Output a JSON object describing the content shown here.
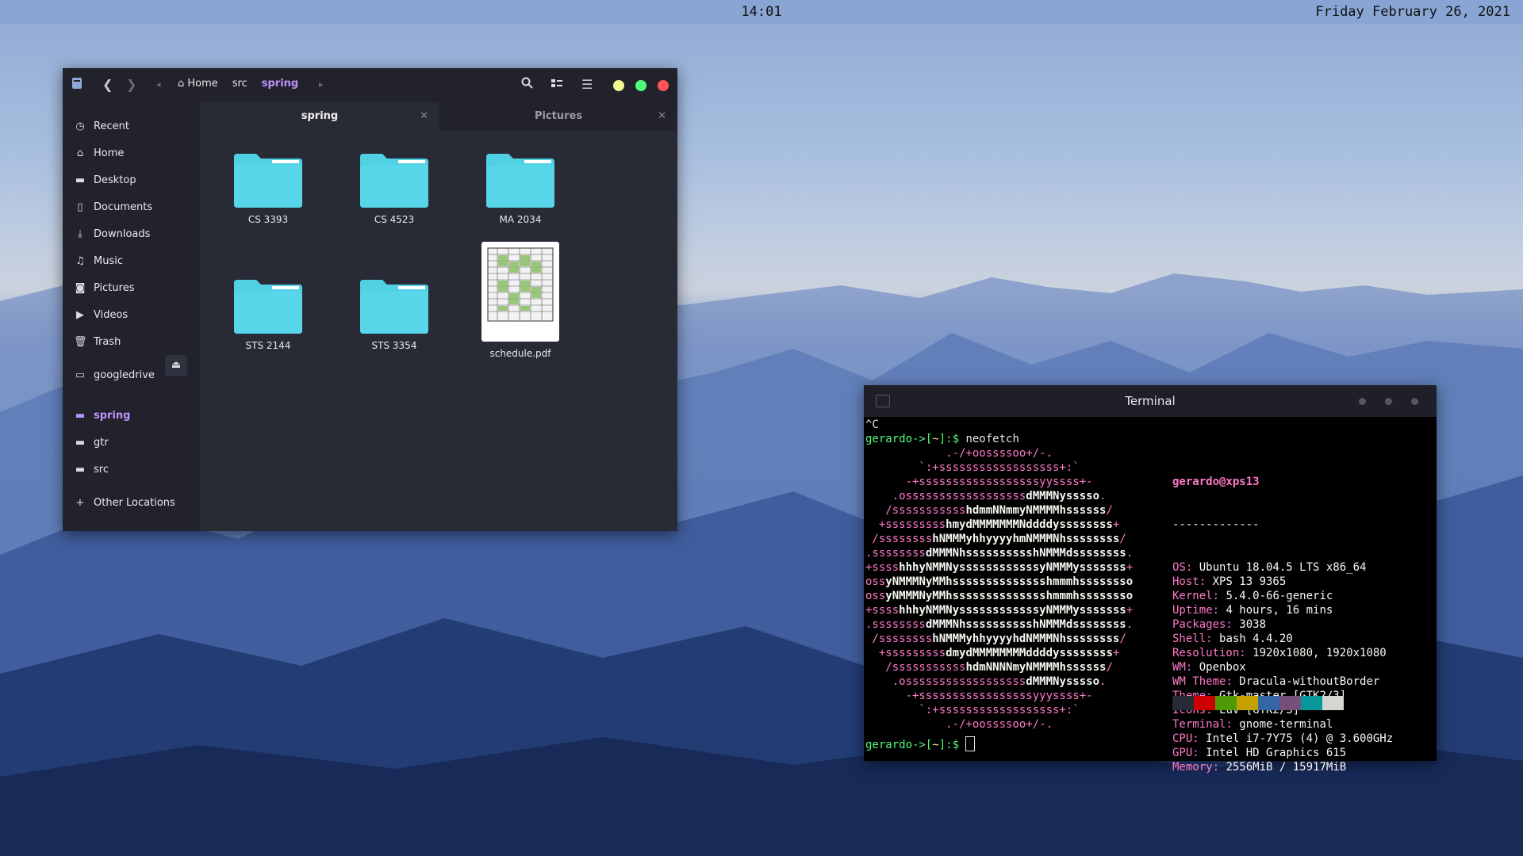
{
  "topbar": {
    "time": "14:01",
    "date": "Friday February 26, 2021"
  },
  "file_manager": {
    "breadcrumbs": [
      "Home",
      "src",
      "spring"
    ],
    "active_crumb": "spring",
    "tabs": [
      {
        "label": "spring",
        "active": true
      },
      {
        "label": "Pictures",
        "active": false
      }
    ],
    "sidebar": {
      "places": [
        {
          "label": "Recent",
          "icon": "clock-icon"
        },
        {
          "label": "Home",
          "icon": "home-icon"
        },
        {
          "label": "Desktop",
          "icon": "folder-icon"
        },
        {
          "label": "Documents",
          "icon": "document-icon"
        },
        {
          "label": "Downloads",
          "icon": "download-icon"
        },
        {
          "label": "Music",
          "icon": "music-icon"
        },
        {
          "label": "Pictures",
          "icon": "camera-icon"
        },
        {
          "label": "Videos",
          "icon": "video-icon"
        },
        {
          "label": "Trash",
          "icon": "trash-icon"
        }
      ],
      "drive": {
        "label": "googledrive",
        "icon": "drive-icon"
      },
      "bookmarks": [
        {
          "label": "spring",
          "icon": "folder-icon",
          "current": true
        },
        {
          "label": "gtr",
          "icon": "folder-icon"
        },
        {
          "label": "src",
          "icon": "folder-icon"
        }
      ],
      "other": {
        "label": "Other Locations",
        "icon": "plus-icon"
      }
    },
    "files": [
      {
        "name": "CS 3393",
        "type": "folder"
      },
      {
        "name": "CS 4523",
        "type": "folder"
      },
      {
        "name": "MA 2034",
        "type": "folder"
      },
      {
        "name": "STS 2144",
        "type": "folder"
      },
      {
        "name": "STS 3354",
        "type": "folder"
      },
      {
        "name": "schedule.pdf",
        "type": "pdf"
      }
    ],
    "colors": {
      "folder": "#4fd1e3",
      "accent": "#bd93f9",
      "close": "#ff5555",
      "maximize": "#50fa7b",
      "minimize": "#f1fa8c"
    }
  },
  "terminal": {
    "title": "Terminal",
    "interrupt": "^C",
    "prompt_user": "gerardo->[",
    "prompt_path": "~",
    "prompt_end": "]:$ ",
    "command": "neofetch",
    "user_host": "gerardo@xps13",
    "separator": "-------------",
    "info": [
      {
        "key": "OS:",
        "value": "Ubuntu 18.04.5 LTS x86_64"
      },
      {
        "key": "Host:",
        "value": "XPS 13 9365"
      },
      {
        "key": "Kernel:",
        "value": "5.4.0-66-generic"
      },
      {
        "key": "Uptime:",
        "value": "4 hours, 16 mins"
      },
      {
        "key": "Packages:",
        "value": "3038"
      },
      {
        "key": "Shell:",
        "value": "bash 4.4.20"
      },
      {
        "key": "Resolution:",
        "value": "1920x1080, 1920x1080"
      },
      {
        "key": "WM:",
        "value": "Openbox"
      },
      {
        "key": "WM Theme:",
        "value": "Dracula-withoutBorder"
      },
      {
        "key": "Theme:",
        "value": "Gtk-master [GTK2/3]"
      },
      {
        "key": "Icons:",
        "value": "Luv [GTK2/3]"
      },
      {
        "key": "Terminal:",
        "value": "gnome-terminal"
      },
      {
        "key": "CPU:",
        "value": "Intel i7-7Y75 (4) @ 3.600GHz"
      },
      {
        "key": "GPU:",
        "value": "Intel HD Graphics 615"
      },
      {
        "key": "Memory:",
        "value": "2556MiB / 15917MiB"
      }
    ],
    "logo": [
      "            .-/+oossssoo+/-.",
      "        `:+ssssssssssssssssss+:`",
      "      -+ssssssssssssssssssyyssss+-",
      "    .ossssssssssssssssssdMMMNysssso.",
      "   /ssssssssssshdmmNNmmyNMMMMhssssss/",
      "  +ssssssssshmydMMMMMMMNddddyssssssss+",
      " /sssssssshNMMMyhhyyyyhmNMMMNhssssssss/",
      ".ssssssssdMMMNhsssssssssshNMMMdssssssss.",
      "+sssshhhyNMMNyssssssssssssyNMMMysssssss+",
      "ossyNMMMNyMMhsssssssssssssshmmmhssssssso",
      "ossyNMMMNyMMhsssssssssssssshmmmhssssssso",
      "+sssshhhyNMMNyssssssssssssyNMMMysssssss+",
      ".ssssssssdMMMNhsssssssssshNMMMdssssssss.",
      " /sssssssshNMMMyhhyyyyhdNMMMNhssssssss/",
      "  +sssssssssdmydMMMMMMMMddddyssssssss+",
      "   /ssssssssssshdmNNNNmyNMMMMhssssss/",
      "    .ossssssssssssssssssdMMMNysssso.",
      "      -+sssssssssssssssssyyyssss+-",
      "        `:+ssssssssssssssssss+:`",
      "            .-/+oossssoo+/-."
    ],
    "palette": [
      "#282a36",
      "#cc0000",
      "#4e9a06",
      "#c4a000",
      "#3465a4",
      "#75507b",
      "#06989a",
      "#d3d7cf"
    ]
  }
}
